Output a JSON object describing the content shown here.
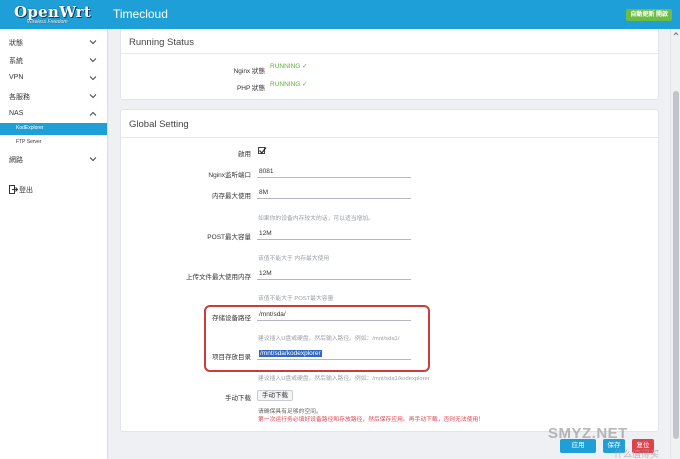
{
  "header": {
    "logo": "OpenWrt",
    "logo_sub": "Wireless Freedom",
    "title": "Timecloud",
    "actions": "自動更新 開啟",
    "accent": "#1e9fd8"
  },
  "sidebar": {
    "items": [
      {
        "label": "狀態",
        "icon": "chevron-down-icon"
      },
      {
        "label": "系統",
        "icon": "chevron-down-icon"
      },
      {
        "label": "VPN",
        "icon": "chevron-down-icon"
      },
      {
        "label": "各服務",
        "icon": "chevron-down-icon"
      },
      {
        "label": "NAS",
        "icon": "chevron-up-icon"
      },
      {
        "label": "網路",
        "icon": "chevron-down-icon"
      }
    ],
    "sub_items": [
      {
        "label": "KodExplorer",
        "active": true
      },
      {
        "label": "FTP Server",
        "active": false
      }
    ],
    "logout": "登出",
    "logout_icon": "logout-icon"
  },
  "running_status": {
    "title": "Running Status",
    "rows": [
      {
        "label": "Nginx 狀態",
        "value": "RUNNING ✓"
      },
      {
        "label": "PHP 狀態",
        "value": "RUNNING ✓"
      }
    ],
    "status_color": "#56b62c"
  },
  "global_setting": {
    "title": "Global Setting",
    "enable_label": "啟用",
    "enable_checked": true,
    "port_label": "Nginx监听端口",
    "port_value": "8081",
    "memory_label": "内存最大使用",
    "memory_value": "8M",
    "memory_hint": "如果你的设备内存较大的话，可以适当增加。",
    "post_label": "POST最大容量",
    "post_value": "12M",
    "post_hint": "该值不能大于 内存最大使用",
    "upload_label": "上传文件最大使用内存",
    "upload_value": "12M",
    "upload_hint": "该值不能大于 POST最大容量",
    "storage_label": "存储设备路径",
    "storage_value": "/mnt/sda/",
    "storage_hint": "建议插入U盘或硬盘，然后输入路径。例如：/mnt/sda1/",
    "project_label": "项目存放目录",
    "project_value": "/mnt/sda/kodexplorer",
    "project_hint": "建议插入U盘或硬盘，然后输入路径。例如：/mnt/sda1/kodexplorer",
    "manual_label": "手动下载",
    "manual_button": "手动下载",
    "manual_hint": "请确保具有足够的空间。",
    "manual_warning": "第一次运行务必填好设备路径和存放路径，然后保存应用。再手动下载，否则无法使用！",
    "warning_color": "#e0424c",
    "highlight_color": "#cf3a3a"
  },
  "footer": {
    "apply_label": "应用",
    "save_label": "保存",
    "reset_label": "复位",
    "watermark": "SMYZ.NET",
    "watermark_sub": "什么值得买"
  }
}
